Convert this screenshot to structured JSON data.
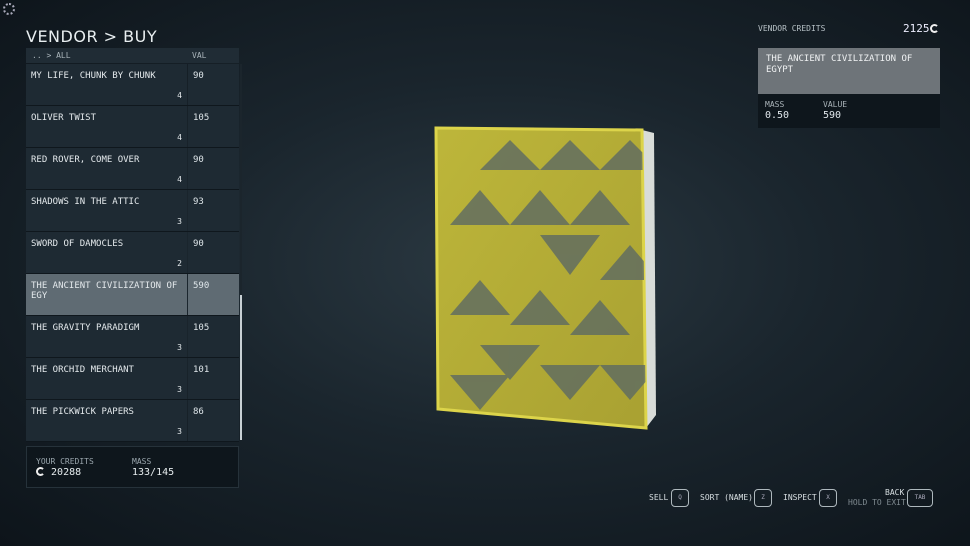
{
  "title": "VENDOR > BUY",
  "list": {
    "breadcrumb": ".. > ALL",
    "val_header": "VAL",
    "items": [
      {
        "name": "MY LIFE, CHUNK BY CHUNK",
        "qty": "4",
        "val": "90"
      },
      {
        "name": "OLIVER TWIST",
        "qty": "4",
        "val": "105"
      },
      {
        "name": "RED ROVER, COME OVER",
        "qty": "4",
        "val": "90"
      },
      {
        "name": "SHADOWS IN THE ATTIC",
        "qty": "3",
        "val": "93"
      },
      {
        "name": "SWORD OF DAMOCLES",
        "qty": "2",
        "val": "90"
      },
      {
        "name": "THE ANCIENT CIVILIZATION OF EGY",
        "qty": "",
        "val": "590",
        "selected": true
      },
      {
        "name": "THE GRAVITY PARADIGM",
        "qty": "3",
        "val": "105"
      },
      {
        "name": "THE ORCHID MERCHANT",
        "qty": "3",
        "val": "101"
      },
      {
        "name": "THE PICKWICK PAPERS",
        "qty": "3",
        "val": "86"
      }
    ]
  },
  "player": {
    "credits_label": "YOUR CREDITS",
    "credits": "20288",
    "mass_label": "MASS",
    "mass": "133/145"
  },
  "vendor": {
    "credits_label": "VENDOR CREDITS",
    "credits": "2125"
  },
  "detail": {
    "name": "THE ANCIENT CIVILIZATION OF EGYPT",
    "mass_label": "MASS",
    "mass": "0.50",
    "value_label": "VALUE",
    "value": "590"
  },
  "controls": {
    "sell": "SELL",
    "sell_key": "Q",
    "sort": "SORT (NAME)",
    "sort_key": "Z",
    "inspect": "INSPECT",
    "inspect_key": "X",
    "back": "BACK",
    "hold": "HOLD TO EXIT",
    "back_key": "TAB"
  },
  "colors": {
    "book": "#c9c23a",
    "selected_row": "#5f6b73"
  }
}
